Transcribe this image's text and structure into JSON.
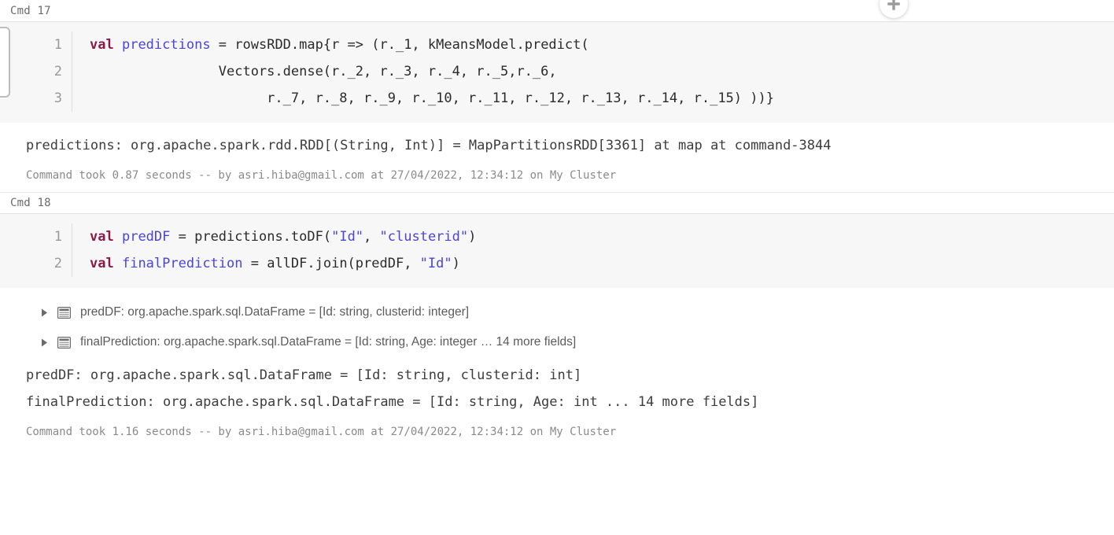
{
  "app": {
    "name": "Databricks Notebook",
    "add_cell_icon": "plus-circle-icon"
  },
  "cells": [
    {
      "id": "cmd17",
      "label": "Cmd 17",
      "language": "scala",
      "code_lines": [
        {
          "number": "1",
          "tokens": [
            {
              "t": "val",
              "c": "kw"
            },
            {
              "t": " ",
              "c": "pln"
            },
            {
              "t": "predictions",
              "c": "idn"
            },
            {
              "t": " = rowsRDD.map{r => (r._1, kMeansModel.predict(",
              "c": "pln"
            }
          ]
        },
        {
          "number": "2",
          "tokens": [
            {
              "t": "                Vectors.dense(r._2, r._3, r._4, r._5,r._6,",
              "c": "pln"
            }
          ]
        },
        {
          "number": "3",
          "tokens": [
            {
              "t": "                      r._7, r._8, r._9, r._10, r._11, r._12, r._13, r._14, r._15) ))}",
              "c": "pln"
            }
          ]
        }
      ],
      "result_lines": [
        "predictions: org.apache.spark.rdd.RDD[(String, Int)] = MapPartitionsRDD[3361] at map at command-3844"
      ],
      "dataframe_rows": [],
      "status": "Command took 0.87 seconds -- by asri.hiba@gmail.com at 27/04/2022, 12:34:12 on My Cluster"
    },
    {
      "id": "cmd18",
      "label": "Cmd 18",
      "language": "scala",
      "code_lines": [
        {
          "number": "1",
          "tokens": [
            {
              "t": "val",
              "c": "kw"
            },
            {
              "t": " ",
              "c": "pln"
            },
            {
              "t": "predDF",
              "c": "idn"
            },
            {
              "t": " = predictions.toDF(",
              "c": "pln"
            },
            {
              "t": "\"Id\"",
              "c": "str"
            },
            {
              "t": ", ",
              "c": "pln"
            },
            {
              "t": "\"clusterid\"",
              "c": "str"
            },
            {
              "t": ")",
              "c": "pln"
            }
          ]
        },
        {
          "number": "2",
          "tokens": [
            {
              "t": "val",
              "c": "kw"
            },
            {
              "t": " ",
              "c": "pln"
            },
            {
              "t": "finalPrediction",
              "c": "idn"
            },
            {
              "t": " = allDF.join(predDF, ",
              "c": "pln"
            },
            {
              "t": "\"Id\"",
              "c": "str"
            },
            {
              "t": ")",
              "c": "pln"
            }
          ]
        }
      ],
      "dataframe_rows": [
        {
          "caret_icon": "caret-right-icon",
          "table_icon": "table-icon",
          "text": "predDF:  org.apache.spark.sql.DataFrame = [Id: string, clusterid: integer]"
        },
        {
          "caret_icon": "caret-right-icon",
          "table_icon": "table-icon",
          "text": "finalPrediction:  org.apache.spark.sql.DataFrame = [Id: string, Age: integer … 14 more fields]"
        }
      ],
      "result_lines": [
        "predDF: org.apache.spark.sql.DataFrame = [Id: string, clusterid: int]",
        "finalPrediction: org.apache.spark.sql.DataFrame = [Id: string, Age: int ... 14 more fields]"
      ],
      "status": "Command took 1.16 seconds -- by asri.hiba@gmail.com at 27/04/2022, 12:34:12 on My Cluster"
    }
  ],
  "colors": {
    "keyword": "#8b1a4a",
    "identifier": "#4a44d8",
    "string": "#4a44d8",
    "plain": "#2b2b2b",
    "code_bg": "#f7f7f7",
    "meta_text": "#8a8a8a",
    "divider": "#e3e3e3"
  }
}
